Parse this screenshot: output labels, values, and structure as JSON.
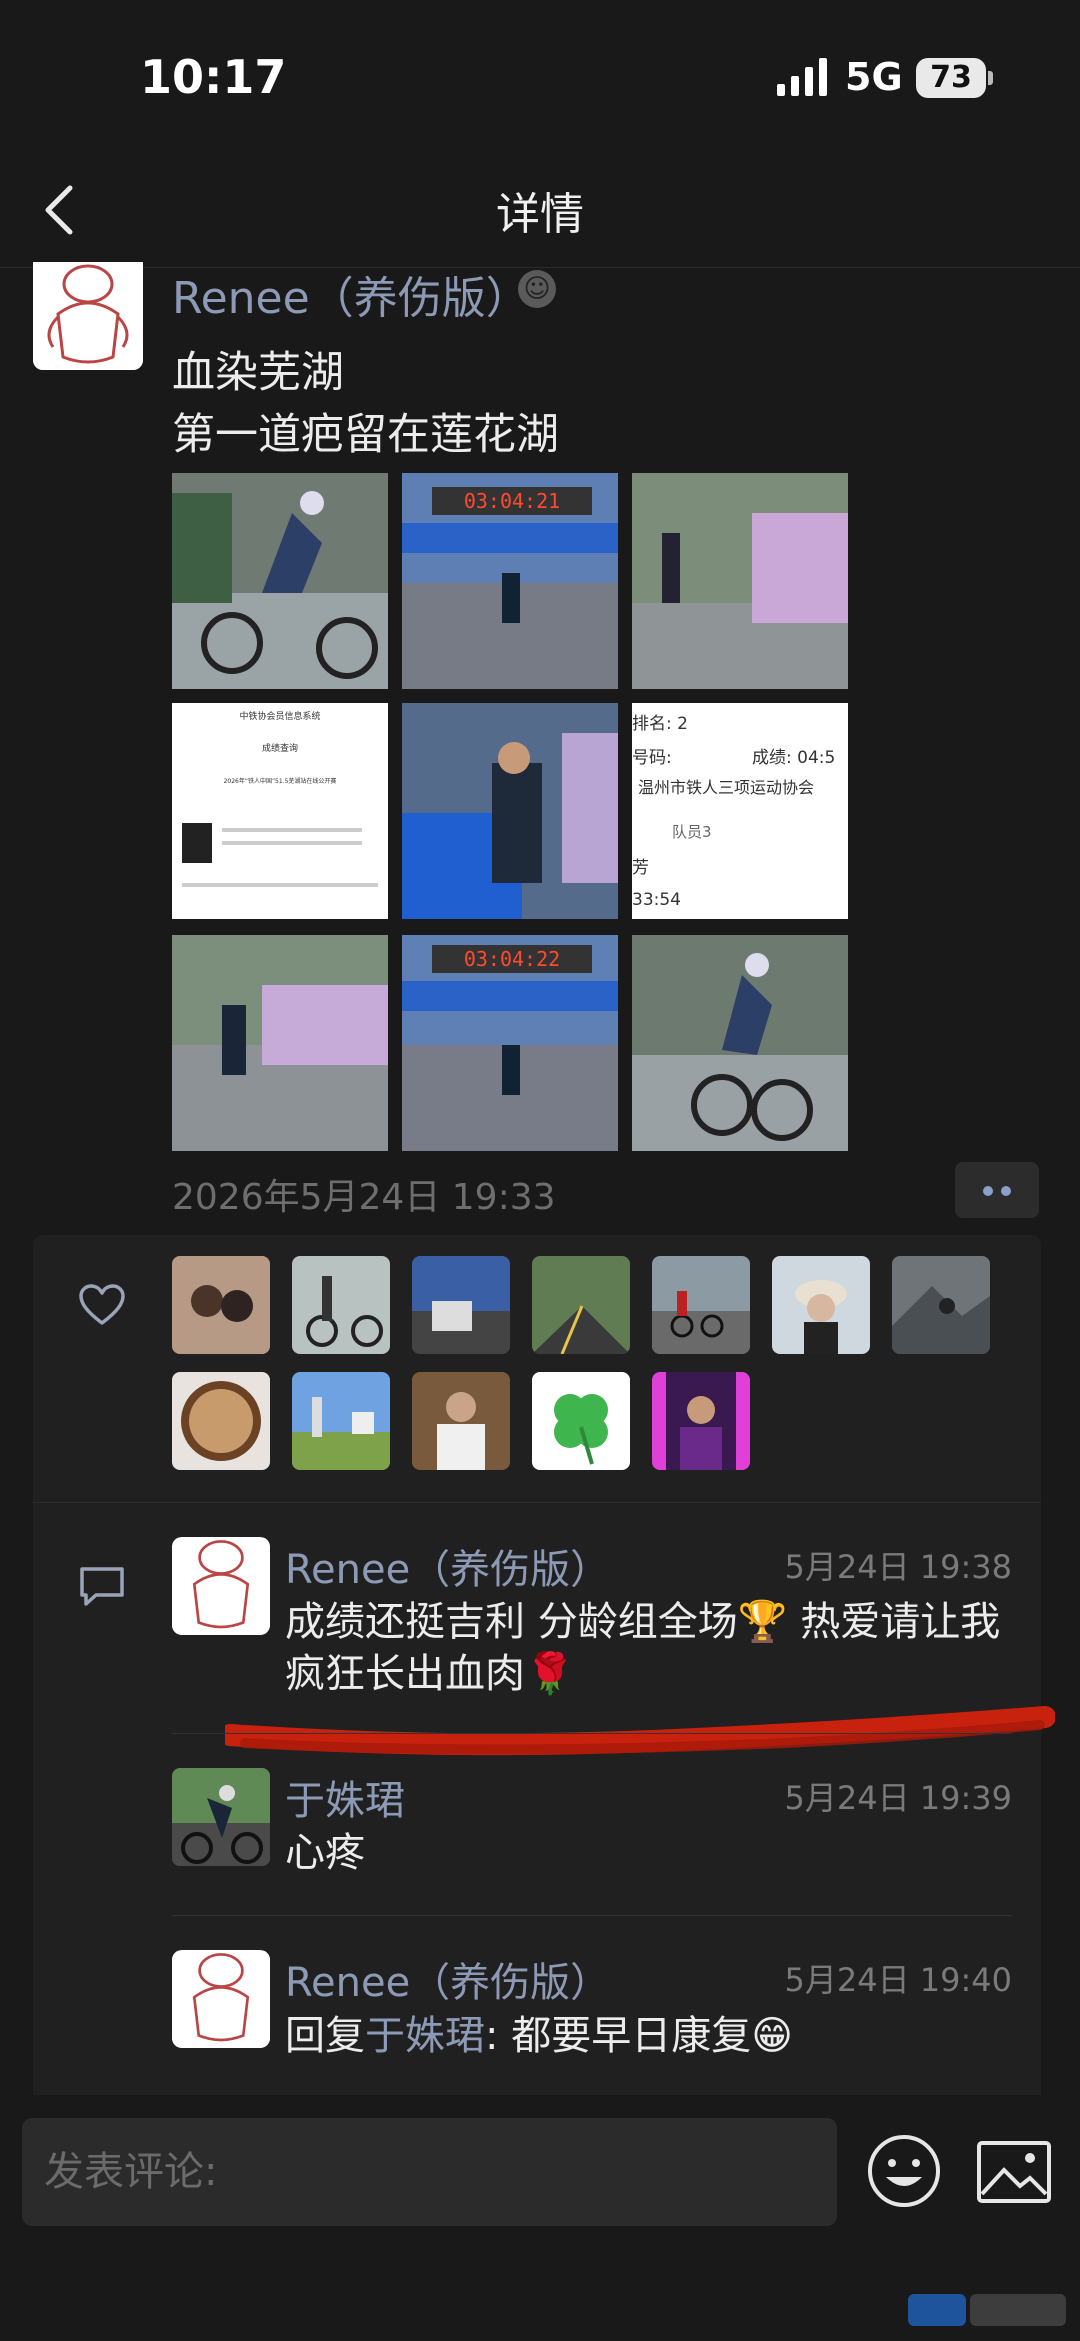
{
  "status_bar": {
    "time": "10:17",
    "network": "5G",
    "battery": "73"
  },
  "nav": {
    "title": "详情"
  },
  "post": {
    "author": "Renee（养伤版）",
    "lines": [
      "血染芜湖",
      "第一道疤留在莲花湖"
    ],
    "timestamp": "2026年5月24日 19:33",
    "photos": [
      {
        "kind": "cyclist-rain"
      },
      {
        "kind": "finish-clock",
        "text": "03:04:21"
      },
      {
        "kind": "volunteers"
      },
      {
        "kind": "results-doc",
        "header": "中铁协会员信息系统",
        "title": "成绩查询",
        "event": "2026年“铁人中国”51.5芜湖站在线公开赛"
      },
      {
        "kind": "runner-closeup"
      },
      {
        "kind": "results-zoom",
        "lines": [
          "排名: 2",
          "号码:",
          "成绩: 04:5",
          "温州市铁人三项运动协会",
          "队员3",
          "芳",
          "33:54"
        ]
      },
      {
        "kind": "runner-volunteers"
      },
      {
        "kind": "finish-clock",
        "text": "03:04:22"
      },
      {
        "kind": "cyclist-rain"
      }
    ]
  },
  "likes": {
    "icon": "heart-icon",
    "avatars": [
      "couple",
      "bike",
      "truck",
      "road",
      "cyclists",
      "girl-hat",
      "mountain",
      "latte",
      "windmill",
      "man-white",
      "clover",
      "neon-portrait"
    ]
  },
  "comments": {
    "icon": "comment-icon",
    "items": [
      {
        "name": "Renee（养伤版）",
        "time": "5月24日 19:38",
        "text": "成绩还挺吉利 分龄组全场🏆 热爱请让我疯狂长出血肉🌹"
      },
      {
        "name": "于姝珺",
        "time": "5月24日 19:39",
        "text": "心疼"
      },
      {
        "name": "Renee（养伤版）",
        "time": "5月24日 19:40",
        "reply_prefix": "回复",
        "reply_to": "于姝珺",
        "text": ": 都要早日康复😁"
      }
    ]
  },
  "composer": {
    "placeholder": "发表评论:"
  },
  "colors": {
    "background": "#191919",
    "panel": "#202020",
    "name": "#8d9ab6",
    "scribble": "#c8220f"
  }
}
